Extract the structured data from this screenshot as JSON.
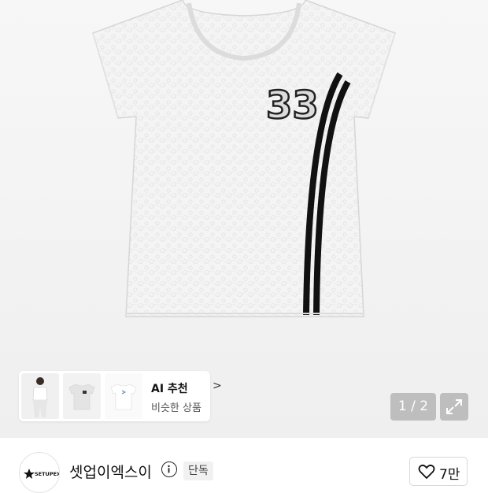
{
  "product": {
    "image_alt": "화이트 레이스 티셔츠 33",
    "print_number": "33"
  },
  "ai_recommend": {
    "title": "AI 추천",
    "subtitle": "비슷한 상품",
    "chevron": ">"
  },
  "gallery": {
    "pager": "1 / 2",
    "expand_icon": "expand-icon"
  },
  "seller": {
    "name": "셋업이엑스이",
    "badge": "단독",
    "logo_text": "SETUPEXE",
    "likes": "7만"
  },
  "colors": {
    "accent": "#111111",
    "background": "#f3f3f3"
  }
}
